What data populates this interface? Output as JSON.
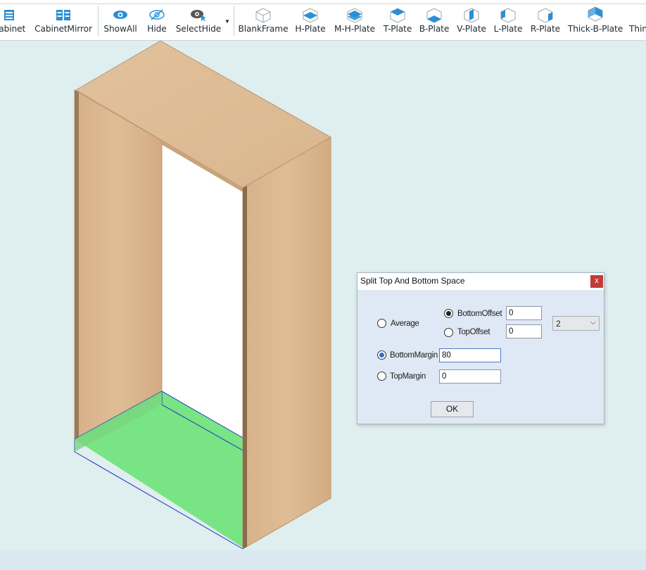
{
  "toolbar": {
    "items": [
      {
        "label": "Cabinet",
        "icon": "cabinet-icon"
      },
      {
        "label": "CabinetMirror",
        "icon": "cabinet-mirror-icon"
      },
      {
        "label": "ShowAll",
        "icon": "eye-icon"
      },
      {
        "label": "Hide",
        "icon": "eye-slash-icon"
      },
      {
        "label": "SelectHide",
        "icon": "eye-select-icon"
      },
      {
        "label": "BlankFrame",
        "icon": "blank-frame-icon"
      },
      {
        "label": "H-Plate",
        "icon": "h-plate-icon"
      },
      {
        "label": "M-H-Plate",
        "icon": "m-h-plate-icon"
      },
      {
        "label": "T-Plate",
        "icon": "t-plate-icon"
      },
      {
        "label": "B-Plate",
        "icon": "b-plate-icon"
      },
      {
        "label": "V-Plate",
        "icon": "v-plate-icon"
      },
      {
        "label": "L-Plate",
        "icon": "l-plate-icon"
      },
      {
        "label": "R-Plate",
        "icon": "r-plate-icon"
      },
      {
        "label": "Thick-B-Plate",
        "icon": "thick-b-plate-icon"
      },
      {
        "label": "Thin",
        "icon": "thin-plate-icon"
      }
    ]
  },
  "colors": {
    "icon_blue": "#2b8fd6",
    "wood": "#ddb98f",
    "highlight_green": "#6fe37a",
    "viewport_bg": "#dfeeee"
  },
  "dialog": {
    "title": "Split Top And Bottom Space",
    "close_glyph": "x",
    "average_label": "Average",
    "bottom_offset_label": "BottomOffset",
    "bottom_offset_value": "0",
    "top_offset_label": "TopOffset",
    "top_offset_value": "0",
    "count_value": "2",
    "bottom_margin_label": "BottomMargin",
    "bottom_margin_value": "80",
    "top_margin_label": "TopMargin",
    "top_margin_value": "0",
    "ok_label": "OK",
    "selected_mode": "BottomMargin",
    "selected_offset": "BottomOffset"
  }
}
